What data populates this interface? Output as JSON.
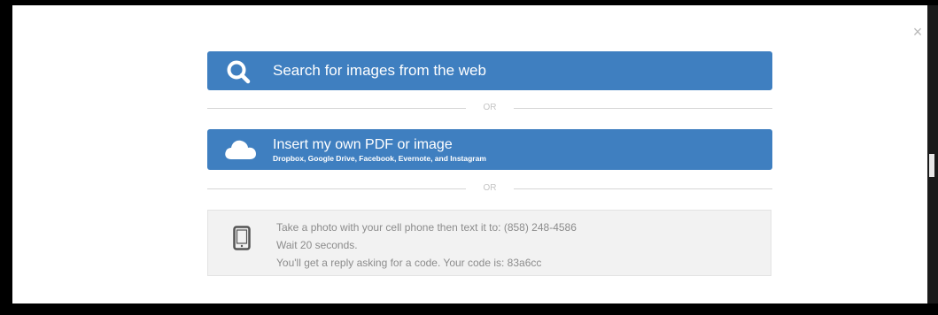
{
  "modal": {
    "close_label": "×"
  },
  "search": {
    "icon": "search-icon",
    "label": "Search for images from the web"
  },
  "separator": {
    "or_label": "OR"
  },
  "insert": {
    "icon": "cloud-icon",
    "label": "Insert my own PDF or image",
    "sub_label": "Dropbox, Google Drive, Facebook, Evernote, and Instagram"
  },
  "phone": {
    "icon": "phone-icon",
    "line1": "Take a photo with your cell phone then text it to: (858) 248-4586",
    "line2": "Wait 20 seconds.",
    "line3": "You'll get a reply asking for a code. Your code is: 83a6cc"
  },
  "colors": {
    "button_blue": "#3f7fc0",
    "box_bg": "#f2f2f2",
    "muted_text": "#8c8c8c"
  }
}
